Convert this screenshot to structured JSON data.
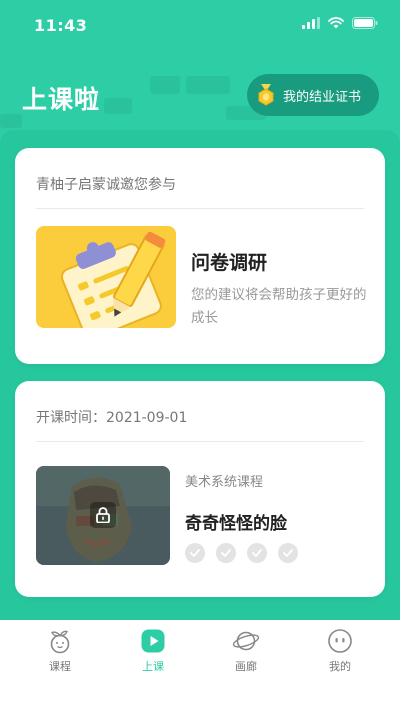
{
  "status_bar": {
    "time": "11:43"
  },
  "header": {
    "title": "上课啦",
    "certificate_button": "我的结业证书"
  },
  "survey_card": {
    "invite_text": "青柚子启蒙诚邀您参与",
    "title": "问卷调研",
    "description": "您的建议将会帮助孩子更好的成长"
  },
  "course_card": {
    "start_date": "开课时间：2021-09-01",
    "category": "美术系统课程",
    "name": "奇奇怪怪的脸",
    "check_count": 4
  },
  "tabbar": {
    "tabs": [
      {
        "label": "课程",
        "icon": "sprout-icon",
        "active": false
      },
      {
        "label": "上课",
        "icon": "play-icon",
        "active": true
      },
      {
        "label": "画廊",
        "icon": "planet-icon",
        "active": false
      },
      {
        "label": "我的",
        "icon": "face-icon",
        "active": false
      }
    ]
  },
  "colors": {
    "primary": "#2dcda6",
    "dark_green": "#189b7e",
    "survey_bg": "#fbcd3c"
  }
}
